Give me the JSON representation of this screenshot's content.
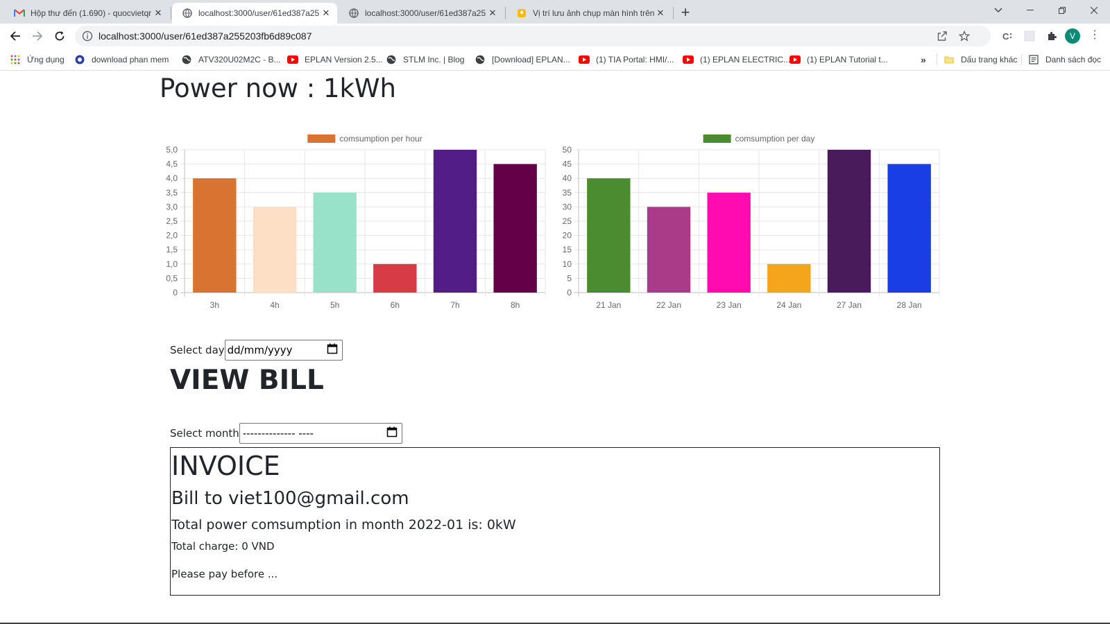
{
  "browser": {
    "tabs": [
      {
        "title": "Hộp thư đến (1.690) - quocvietqr",
        "favicon": "gmail-icon",
        "active": false
      },
      {
        "title": "localhost:3000/user/61ed387a25",
        "favicon": "globe-icon",
        "active": true
      },
      {
        "title": "localhost:3000/user/61ed387a25",
        "favicon": "globe-icon",
        "active": false
      },
      {
        "title": "Vị trí lưu ảnh chụp màn hình trên",
        "favicon": "pin-icon",
        "active": false
      }
    ],
    "url": "localhost:3000/user/61ed387a255203fb6d89c087",
    "profile_initial": "V",
    "bookmarks": [
      {
        "label": "Ứng dụng",
        "icon": "apps-grid-icon"
      },
      {
        "label": "download phan mem",
        "icon": "circle-icon"
      },
      {
        "label": "ATV320U02M2C - B...",
        "icon": "globe-icon"
      },
      {
        "label": "EPLAN Version 2.5...",
        "icon": "youtube-icon"
      },
      {
        "label": "STLM Inc. | Blog",
        "icon": "globe-icon"
      },
      {
        "label": "[Download] EPLAN...",
        "icon": "globe-icon"
      },
      {
        "label": "(1) TIA Portal: HMI/...",
        "icon": "youtube-icon"
      },
      {
        "label": "(1) EPLAN ELECTRIC...",
        "icon": "youtube-icon"
      },
      {
        "label": "(1) EPLAN Tutorial t...",
        "icon": "youtube-icon"
      }
    ],
    "bookmarks_more": "»",
    "other_bookmarks": "Dấu trang khác",
    "reading_list": "Danh sách đọc"
  },
  "page": {
    "power_now": "Power now : 1kWh",
    "select_day_label": "Select day",
    "day_placeholder": "dd/mm/yyyy",
    "view_bill": "VIEW BILL",
    "select_month_label": "Select month",
    "month_placeholder": "-------------- ----",
    "invoice": {
      "title": "INVOICE",
      "bill_to": "Bill to viet100@gmail.com",
      "total_power": "Total power comsumption in month 2022-01 is: 0kW",
      "total_charge": "Total charge: 0 VND",
      "pay_before": "Please pay before ..."
    }
  },
  "chart_data": [
    {
      "type": "bar",
      "legend": "comsumption per hour",
      "legend_color": "#d87332",
      "categories": [
        "3h",
        "4h",
        "5h",
        "6h",
        "7h",
        "8h"
      ],
      "values": [
        4,
        3,
        3.5,
        1,
        5,
        4.5
      ],
      "colors": [
        "#d87332",
        "#fddfc6",
        "#98e2ca",
        "#d73b45",
        "#521d87",
        "#640048"
      ],
      "ylim": [
        0,
        5
      ],
      "yticks": [
        "0",
        "0,5",
        "1,0",
        "1,5",
        "2,0",
        "2,5",
        "3,0",
        "3,5",
        "4,0",
        "4,5",
        "5,0"
      ],
      "grid": true,
      "legend_position": "top"
    },
    {
      "type": "bar",
      "legend": "comsumption per day",
      "legend_color": "#4a8c2f",
      "categories": [
        "21 Jan",
        "22 Jan",
        "23 Jan",
        "24 Jan",
        "27 Jan",
        "28 Jan"
      ],
      "values": [
        40,
        30,
        35,
        10,
        50,
        45
      ],
      "colors": [
        "#4a8c2f",
        "#aa3b89",
        "#ff0bb1",
        "#f5a51c",
        "#4a1b5b",
        "#1a3ee6"
      ],
      "ylim": [
        0,
        50
      ],
      "yticks": [
        "0",
        "5",
        "10",
        "15",
        "20",
        "25",
        "30",
        "35",
        "40",
        "45",
        "50"
      ],
      "grid": true,
      "legend_position": "top"
    }
  ]
}
